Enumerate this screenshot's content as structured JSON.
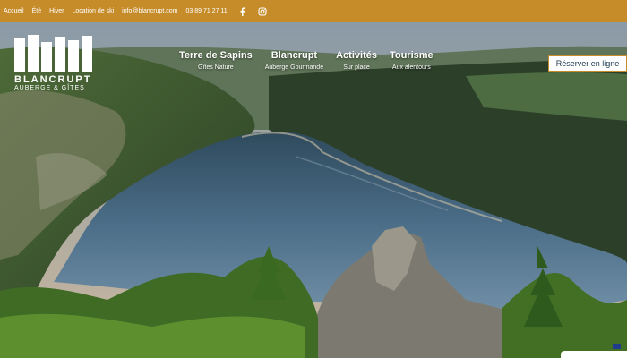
{
  "topbar": {
    "links": [
      "Accueil",
      "Été",
      "Hiver",
      "Location de ski",
      "info@blancrupt.com",
      "03 89 71 27 11"
    ],
    "icons": [
      "facebook-icon",
      "instagram-icon"
    ],
    "background_color": "#c68c2a"
  },
  "logo": {
    "name": "BLANCRUPT",
    "subtitle": "AUBERGE & GÎTES"
  },
  "nav": [
    {
      "title": "Terre de Sapins",
      "subtitle": "Gîtes Nature"
    },
    {
      "title": "Blancrupt",
      "subtitle": "Auberge Gourmande"
    },
    {
      "title": "Activités",
      "subtitle": "Sur place"
    },
    {
      "title": "Tourisme",
      "subtitle": "Aux alentours"
    }
  ],
  "cta": {
    "label": "Réserver en ligne"
  },
  "colors": {
    "accent": "#c68c2a",
    "lake": "#3d5a70"
  }
}
